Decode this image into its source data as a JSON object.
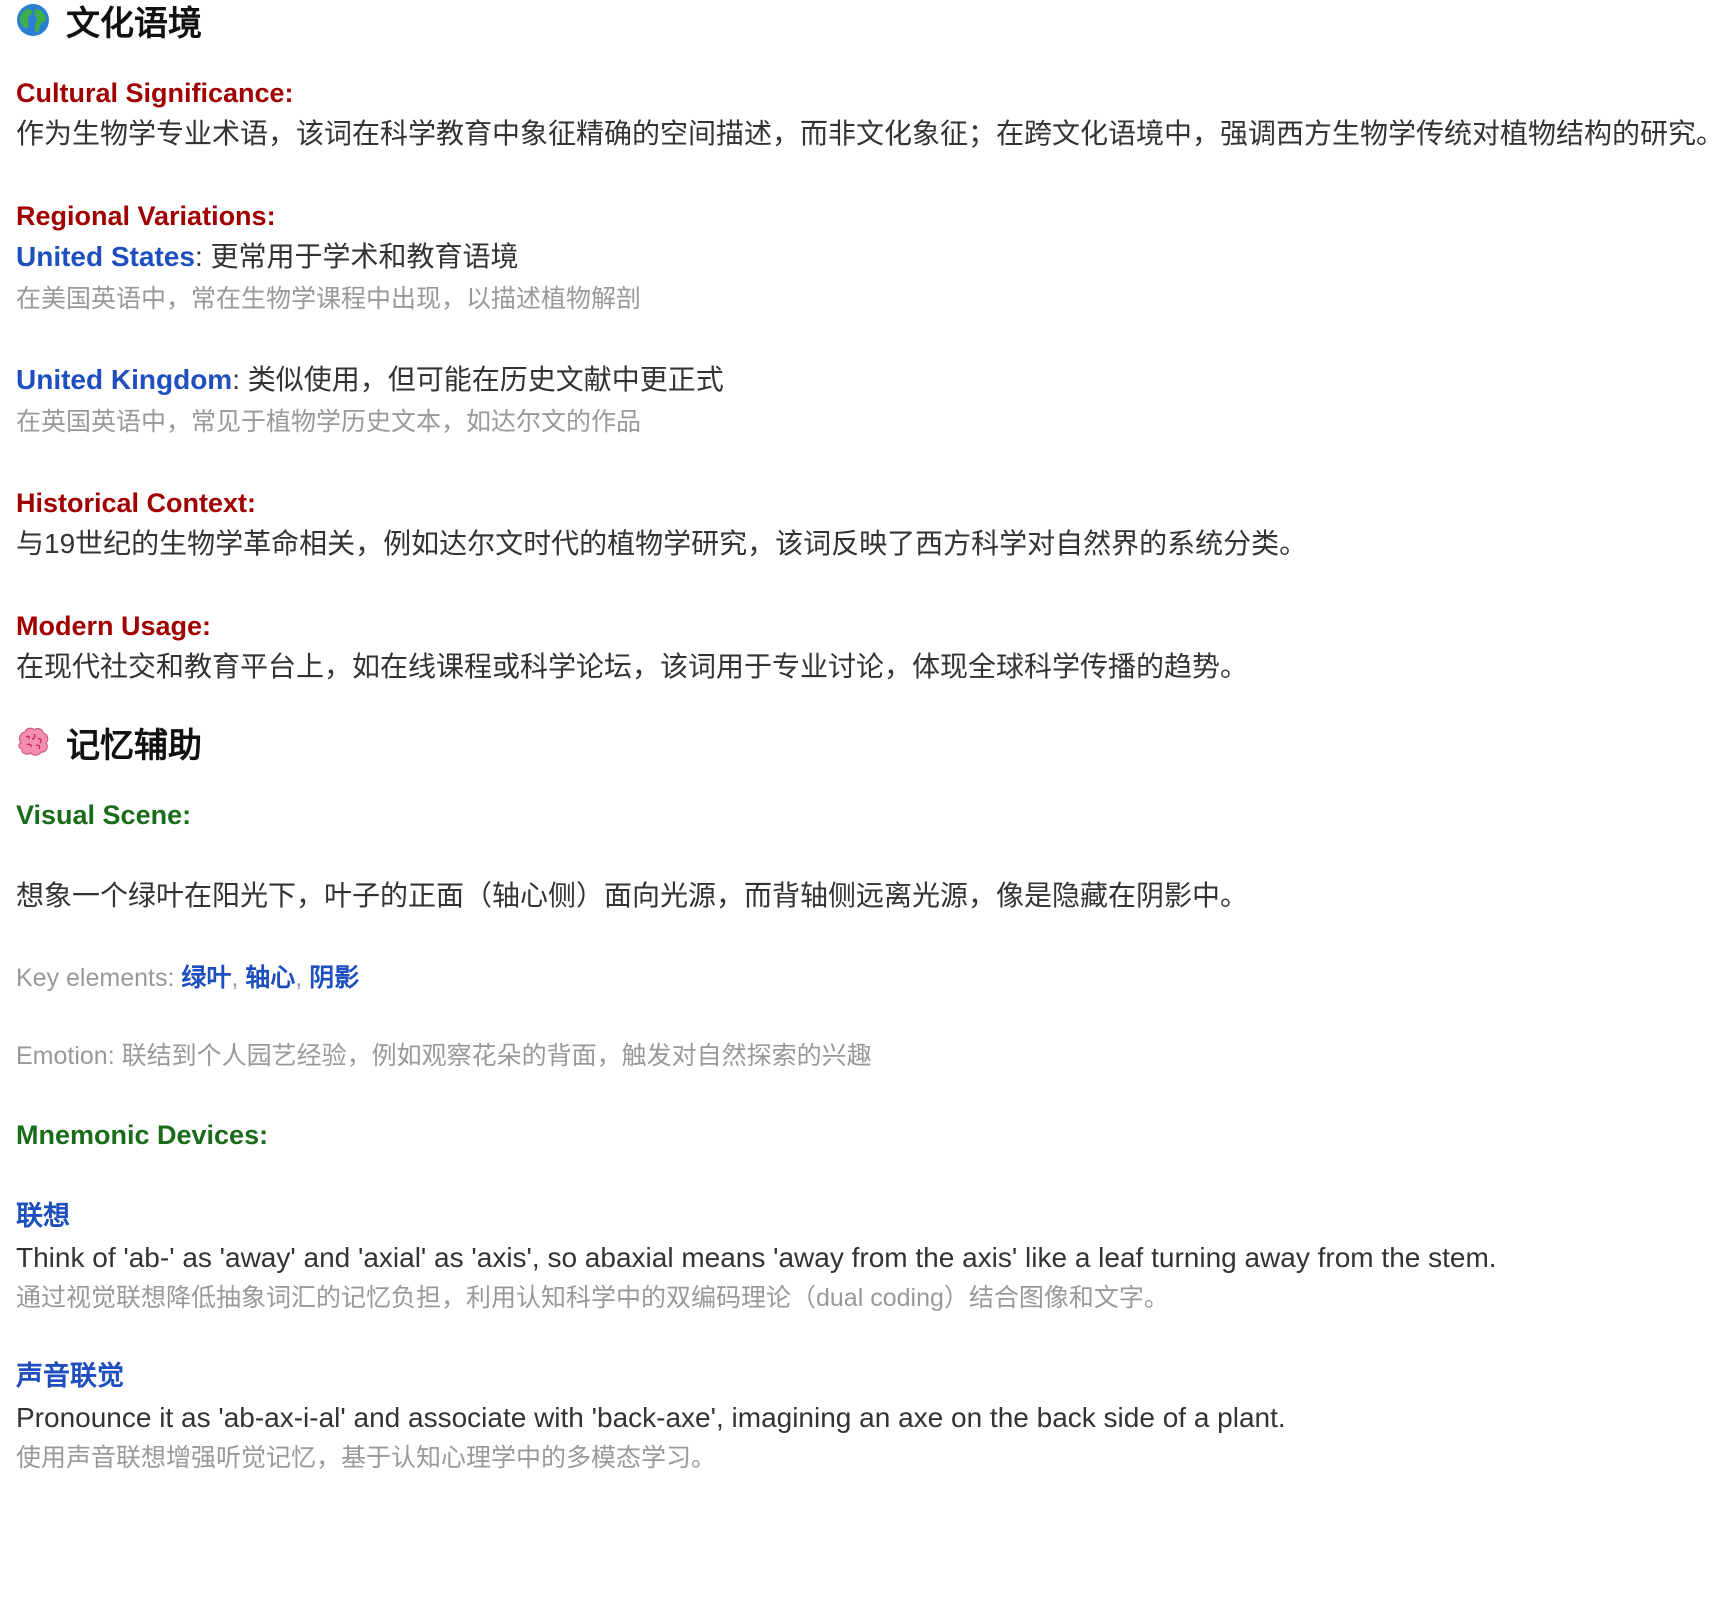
{
  "culture": {
    "title": "文化语境",
    "icon": "globe-icon",
    "cultural_significance": {
      "label": "Cultural Significance:",
      "text": "作为生物学专业术语，该词在科学教育中象征精确的空间描述，而非文化象征；在跨文化语境中，强调西方生物学传统对植物结构的研究。"
    },
    "regional_variations": {
      "label": "Regional Variations:",
      "items": [
        {
          "region": "United States",
          "sep": ": ",
          "desc": "更常用于学术和教育语境",
          "note": "在美国英语中，常在生物学课程中出现，以描述植物解剖"
        },
        {
          "region": "United Kingdom",
          "sep": ": ",
          "desc": "类似使用，但可能在历史文献中更正式",
          "note": "在英国英语中，常见于植物学历史文本，如达尔文的作品"
        }
      ]
    },
    "historical_context": {
      "label": "Historical Context:",
      "text": "与19世纪的生物学革命相关，例如达尔文时代的植物学研究，该词反映了西方科学对自然界的系统分类。"
    },
    "modern_usage": {
      "label": "Modern Usage:",
      "text": "在现代社交和教育平台上，如在线课程或科学论坛，该词用于专业讨论，体现全球科学传播的趋势。"
    }
  },
  "memory": {
    "title": "记忆辅助",
    "icon": "brain-icon",
    "visual_scene": {
      "label": "Visual Scene:",
      "text": "想象一个绿叶在阳光下，叶子的正面（轴心侧）面向光源，而背轴侧远离光源，像是隐藏在阴影中。",
      "key_elements_label": "Key elements: ",
      "key_elements": [
        "绿叶",
        "轴心",
        "阴影"
      ],
      "key_sep": ", ",
      "emotion_label": "Emotion: ",
      "emotion_text": "联结到个人园艺经验，例如观察花朵的背面，触发对自然探索的兴趣"
    },
    "mnemonic_devices": {
      "label": "Mnemonic Devices:",
      "items": [
        {
          "title": "联想",
          "text": "Think of 'ab-' as 'away' and 'axial' as 'axis', so abaxial means 'away from the axis' like a leaf turning away from the stem.",
          "note": "通过视觉联想降低抽象词汇的记忆负担，利用认知科学中的双编码理论（dual coding）结合图像和文字。"
        },
        {
          "title": "声音联觉",
          "text": "Pronounce it as 'ab-ax-i-al' and associate with 'back-axe', imagining an axe on the back side of a plant.",
          "note": "使用声音联想增强听觉记忆，基于认知心理学中的多模态学习。"
        }
      ]
    }
  }
}
